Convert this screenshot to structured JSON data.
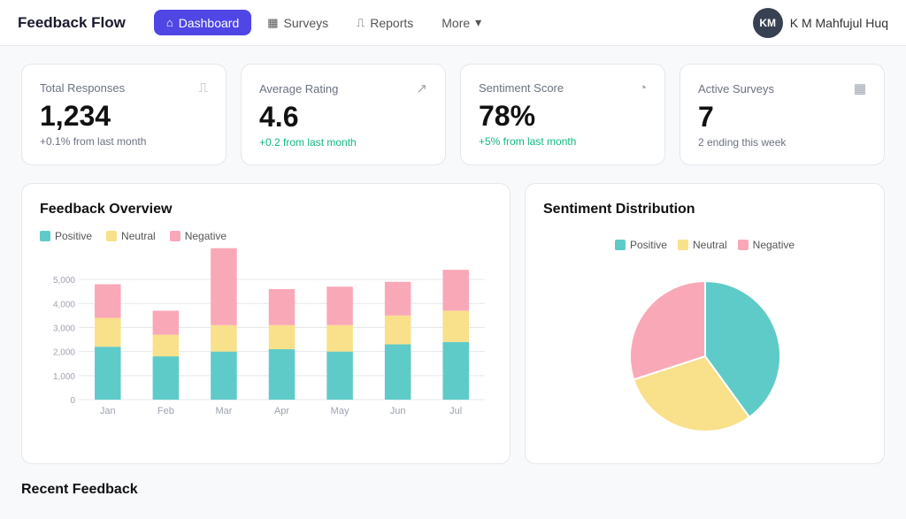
{
  "brand": "Feedback Flow",
  "nav": {
    "items": [
      {
        "id": "dashboard",
        "label": "Dashboard",
        "icon": "⌂",
        "active": true
      },
      {
        "id": "surveys",
        "label": "Surveys",
        "icon": "▦",
        "active": false
      },
      {
        "id": "reports",
        "label": "Reports",
        "icon": "⎍",
        "active": false
      },
      {
        "id": "more",
        "label": "More",
        "icon": "",
        "active": false
      }
    ],
    "more_label": "More",
    "chevron": "▾"
  },
  "user": {
    "name": "K M Mahfujul Huq",
    "initials": "KM"
  },
  "metrics": [
    {
      "id": "total-responses",
      "label": "Total Responses",
      "value": "1,234",
      "sub": "+0.1% from last month",
      "sub_type": "neutral",
      "icon": "⎍"
    },
    {
      "id": "average-rating",
      "label": "Average Rating",
      "value": "4.6",
      "sub": "+0.2 from last month",
      "sub_type": "green",
      "icon": "↗"
    },
    {
      "id": "sentiment-score",
      "label": "Sentiment Score",
      "value": "78%",
      "sub": "+5% from last month",
      "sub_type": "green",
      "icon": "◔"
    },
    {
      "id": "active-surveys",
      "label": "Active Surveys",
      "value": "7",
      "sub": "2 ending this week",
      "sub_type": "neutral",
      "icon": "▦"
    }
  ],
  "bar_chart": {
    "title": "Feedback Overview",
    "legend": [
      {
        "label": "Positive",
        "color": "#5ecbc8"
      },
      {
        "label": "Neutral",
        "color": "#f9e08b"
      },
      {
        "label": "Negative",
        "color": "#f9a8b8"
      }
    ],
    "y_labels": [
      "5,000",
      "4,000",
      "3,000",
      "2,000",
      "1,000",
      "0"
    ],
    "bars": [
      {
        "month": "Jan",
        "positive": 2200,
        "neutral": 1200,
        "negative": 1400
      },
      {
        "month": "Feb",
        "positive": 1800,
        "neutral": 900,
        "negative": 1000
      },
      {
        "month": "Mar",
        "positive": 2000,
        "neutral": 1100,
        "negative": 3200
      },
      {
        "month": "Apr",
        "positive": 2100,
        "neutral": 1000,
        "negative": 1500
      },
      {
        "month": "May",
        "positive": 2000,
        "neutral": 1100,
        "negative": 1600
      },
      {
        "month": "Jun",
        "positive": 2300,
        "neutral": 1200,
        "negative": 1400
      },
      {
        "month": "Jul",
        "positive": 2400,
        "neutral": 1300,
        "negative": 1700
      }
    ],
    "max_value": 6400
  },
  "pie_chart": {
    "title": "Sentiment Distribution",
    "legend": [
      {
        "label": "Positive",
        "color": "#5ecbc8"
      },
      {
        "label": "Neutral",
        "color": "#f9e08b"
      },
      {
        "label": "Negative",
        "color": "#f9a8b8"
      }
    ],
    "segments": [
      {
        "label": "Positive",
        "value": 40,
        "color": "#5ecbc8"
      },
      {
        "label": "Neutral",
        "value": 30,
        "color": "#f9e08b"
      },
      {
        "label": "Negative",
        "value": 30,
        "color": "#f9a8b8"
      }
    ]
  },
  "recent_section": {
    "title": "Recent Feedback"
  }
}
